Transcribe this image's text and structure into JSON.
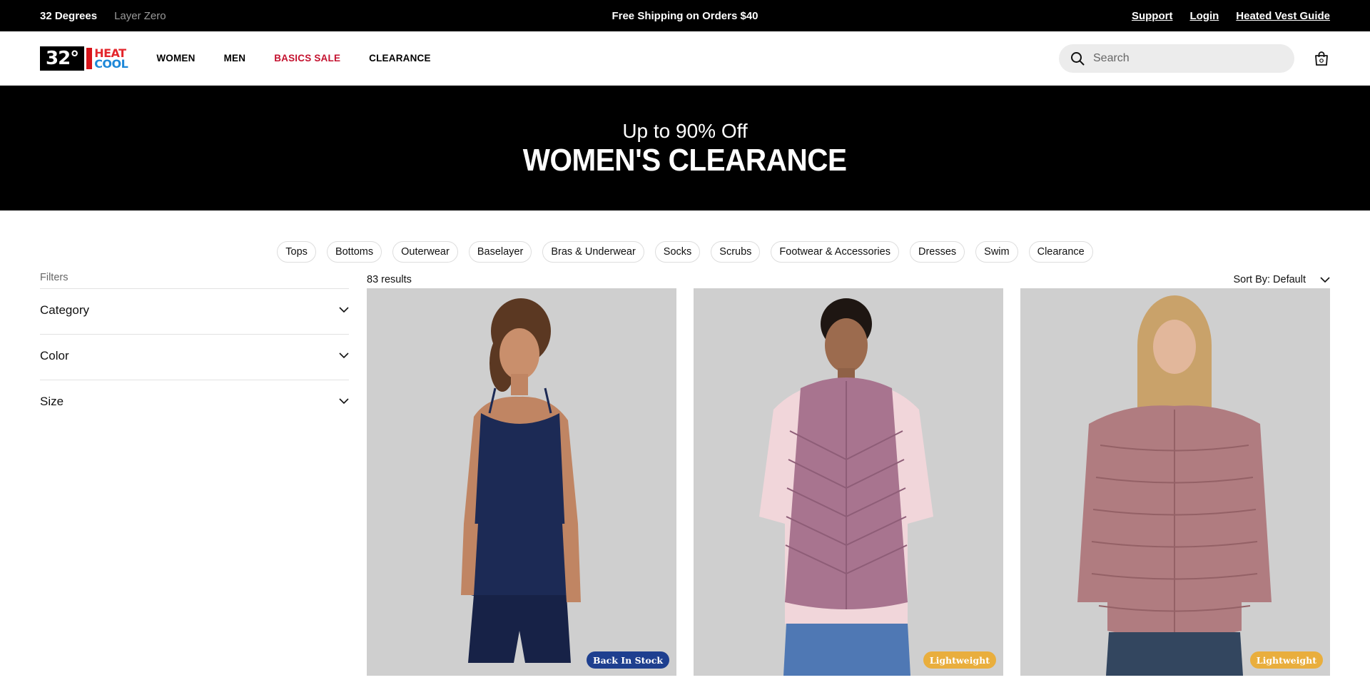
{
  "utility_bar": {
    "brands": [
      "32 Degrees",
      "Layer Zero"
    ],
    "promo": "Free Shipping on Orders $40",
    "links": [
      "Support",
      "Login",
      "Heated Vest Guide"
    ]
  },
  "header": {
    "logo": {
      "number": "32°",
      "word_top": "HEAT",
      "word_bottom": "COOL"
    },
    "nav": [
      "WOMEN",
      "MEN",
      "BASICS SALE",
      "CLEARANCE"
    ],
    "search_placeholder": "Search",
    "icons": {
      "search": "search-icon",
      "cart": "shopping-bag-icon"
    }
  },
  "hero": {
    "subtitle": "Up to 90% Off",
    "title": "WOMEN'S CLEARANCE"
  },
  "categories": [
    "Tops",
    "Bottoms",
    "Outerwear",
    "Baselayer",
    "Bras & Underwear",
    "Socks",
    "Scrubs",
    "Footwear & Accessories",
    "Dresses",
    "Swim",
    "Clearance"
  ],
  "filters": {
    "label": "Filters",
    "groups": [
      "Category",
      "Color",
      "Size"
    ]
  },
  "results": {
    "count": "83 results",
    "sort": "Sort By: Default"
  },
  "products": [
    {
      "badge": "Back In Stock",
      "badge_color": "#1e3f8f",
      "garment_color": "#1c2a55"
    },
    {
      "badge": "Lightweight",
      "badge_color": "#e9ae3d",
      "garment_color": "#a8748f"
    },
    {
      "badge": "Lightweight",
      "badge_color": "#e9ae3d",
      "garment_color": "#b07c80"
    }
  ],
  "colors": {
    "accent_sale": "#c4122f",
    "logo_heat": "#e3262c",
    "logo_cool": "#1e88d8"
  }
}
